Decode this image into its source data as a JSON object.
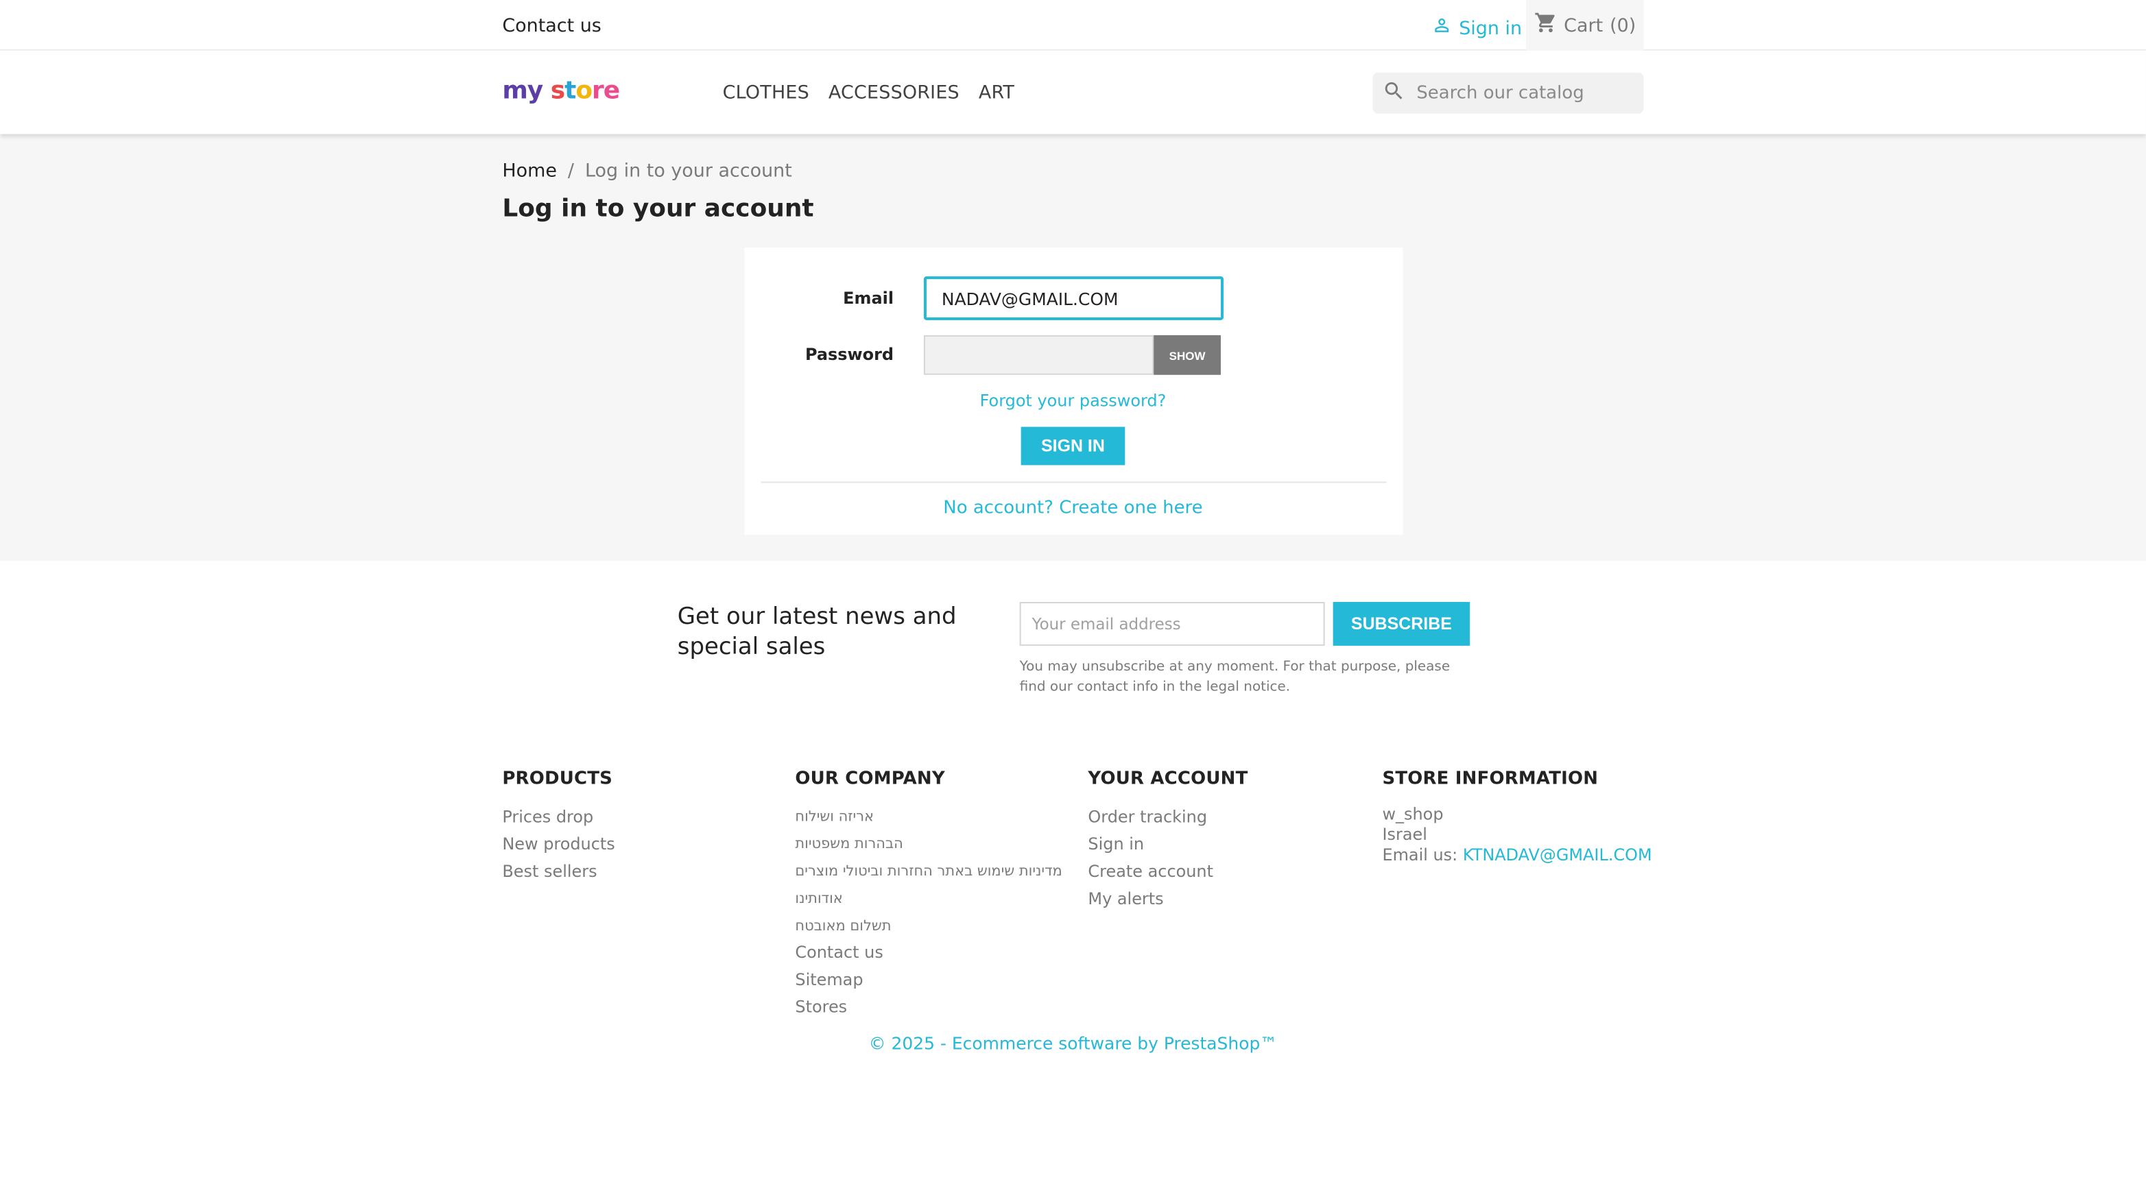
{
  "topbar": {
    "contact_label": "Contact us",
    "signin_label": "Sign in",
    "cart_label": "Cart",
    "cart_count": "(0)"
  },
  "header": {
    "logo_parts": [
      "my",
      " ",
      "s",
      "t",
      "o",
      "re"
    ],
    "nav": [
      "CLOTHES",
      "ACCESSORIES",
      "ART"
    ],
    "search_placeholder": "Search our catalog"
  },
  "breadcrumb": {
    "home": "Home",
    "separator": "/",
    "current": "Log in to your account"
  },
  "page_title": "Log in to your account",
  "login_form": {
    "email_label": "Email",
    "email_value": "NADAV@GMAIL.COM",
    "password_label": "Password",
    "password_value": "",
    "show_label": "SHOW",
    "forgot_label": "Forgot your password?",
    "signin_label": "SIGN IN",
    "no_account_label": "No account? Create one here"
  },
  "newsletter": {
    "title": "Get our latest news and special sales",
    "email_placeholder": "Your email address",
    "subscribe_label": "SUBSCRIBE",
    "note": "You may unsubscribe at any moment. For that purpose, please find our contact info in the legal notice."
  },
  "footer": {
    "products": {
      "title": "PRODUCTS",
      "items": [
        "Prices drop",
        "New products",
        "Best sellers"
      ]
    },
    "our_company": {
      "title": "OUR COMPANY",
      "items": [
        "אריזה ושילוח",
        "הבהרות משפטיות",
        "מדיניות שימוש באתר החזרות וביטולי מוצרים",
        "אודותינו",
        "תשלום מאובטח",
        "Contact us",
        "Sitemap",
        "Stores"
      ]
    },
    "your_account": {
      "title": "YOUR ACCOUNT",
      "items": [
        "Order tracking",
        "Sign in",
        "Create account",
        "My alerts"
      ]
    },
    "store_information": {
      "title": "STORE INFORMATION",
      "name": "w_shop",
      "country": "Israel",
      "email_label": "Email us:",
      "email": "KTNADAV@GMAIL.COM"
    },
    "copyright": "© 2025 - Ecommerce software by PrestaShop™"
  },
  "colors": {
    "accent": "#24b9d7",
    "text": "#232323",
    "muted": "#7a7a7a",
    "grey_bg": "#f6f6f6"
  },
  "icons": {
    "signin": "person-icon",
    "cart": "shopping-cart-icon",
    "search": "search-icon"
  }
}
